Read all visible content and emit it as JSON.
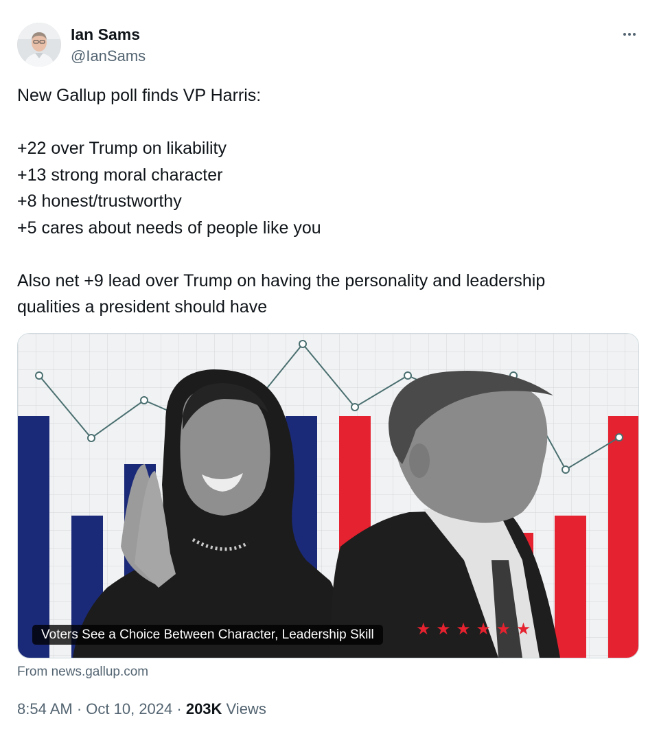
{
  "author": {
    "name": "Ian Sams",
    "handle": "@IanSams"
  },
  "icons": {
    "more": "more-options-icon",
    "avatar": "profile-photo"
  },
  "tweet": {
    "lines": [
      "New Gallup poll finds VP Harris:",
      "",
      "+22 over Trump on likability",
      "+13 strong moral character",
      "+8 honest/trustworthy",
      "+5 cares about needs of people like you",
      "",
      "Also net +9 lead over Trump on having the personality and leadership",
      "qualities a president should have"
    ]
  },
  "card": {
    "title": "Voters See a Choice Between Character, Leadership Skill",
    "source": "From news.gallup.com",
    "colors": {
      "blue": "#1b2a78",
      "red": "#e5222f",
      "grid": "#d3d6da",
      "line": "#4a6f70"
    }
  },
  "meta": {
    "time": "8:54 AM",
    "separator": " · ",
    "date": "Oct 10, 2024",
    "views_count": "203K",
    "views_label": " Views"
  }
}
